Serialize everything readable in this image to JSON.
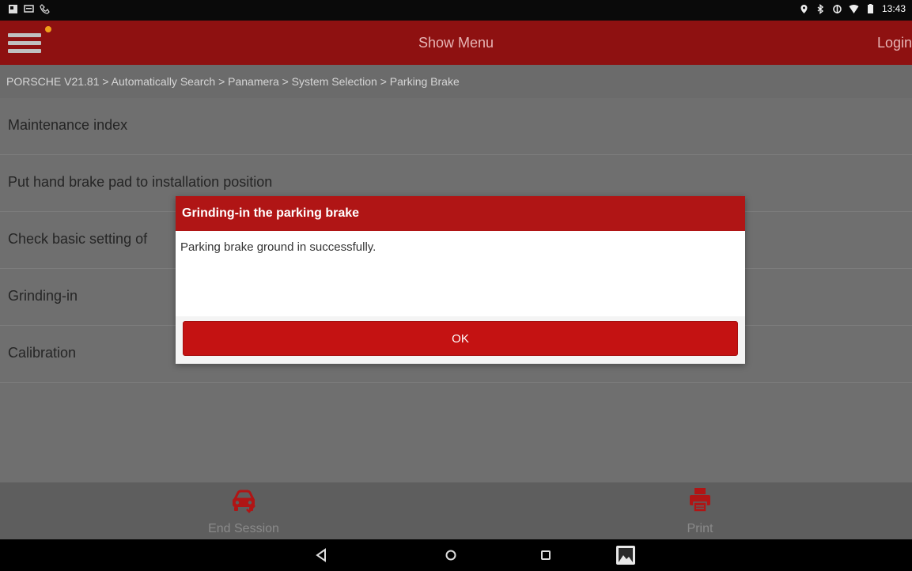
{
  "status_bar": {
    "time": "13:43",
    "icons_left": [
      "notification-icon",
      "message-icon",
      "phone-icon"
    ],
    "icons_right": [
      "location-icon",
      "bluetooth-icon",
      "sync-icon",
      "wifi-icon",
      "battery-icon"
    ]
  },
  "header": {
    "title": "Show Menu",
    "login": "Login",
    "menu_icon": "hamburger-menu-icon",
    "accent_color": "#8e1111"
  },
  "breadcrumb": "PORSCHE V21.81 > Automatically Search > Panamera > System Selection > Parking Brake",
  "menu_items": [
    "Maintenance index",
    "Put hand brake pad to installation position",
    "Check basic setting of",
    "Grinding-in",
    "Calibration"
  ],
  "dialog": {
    "title": "Grinding-in the parking brake",
    "message": "Parking brake ground in successfully.",
    "ok_label": "OK",
    "header_color": "#b01515",
    "button_color": "#c41212"
  },
  "bottom_bar": {
    "end_session": "End Session",
    "print": "Print",
    "icon_color": "#b01515"
  },
  "nav_bar": {
    "icons": [
      "back-icon",
      "home-icon",
      "recents-icon",
      "screenshot-icon"
    ]
  }
}
